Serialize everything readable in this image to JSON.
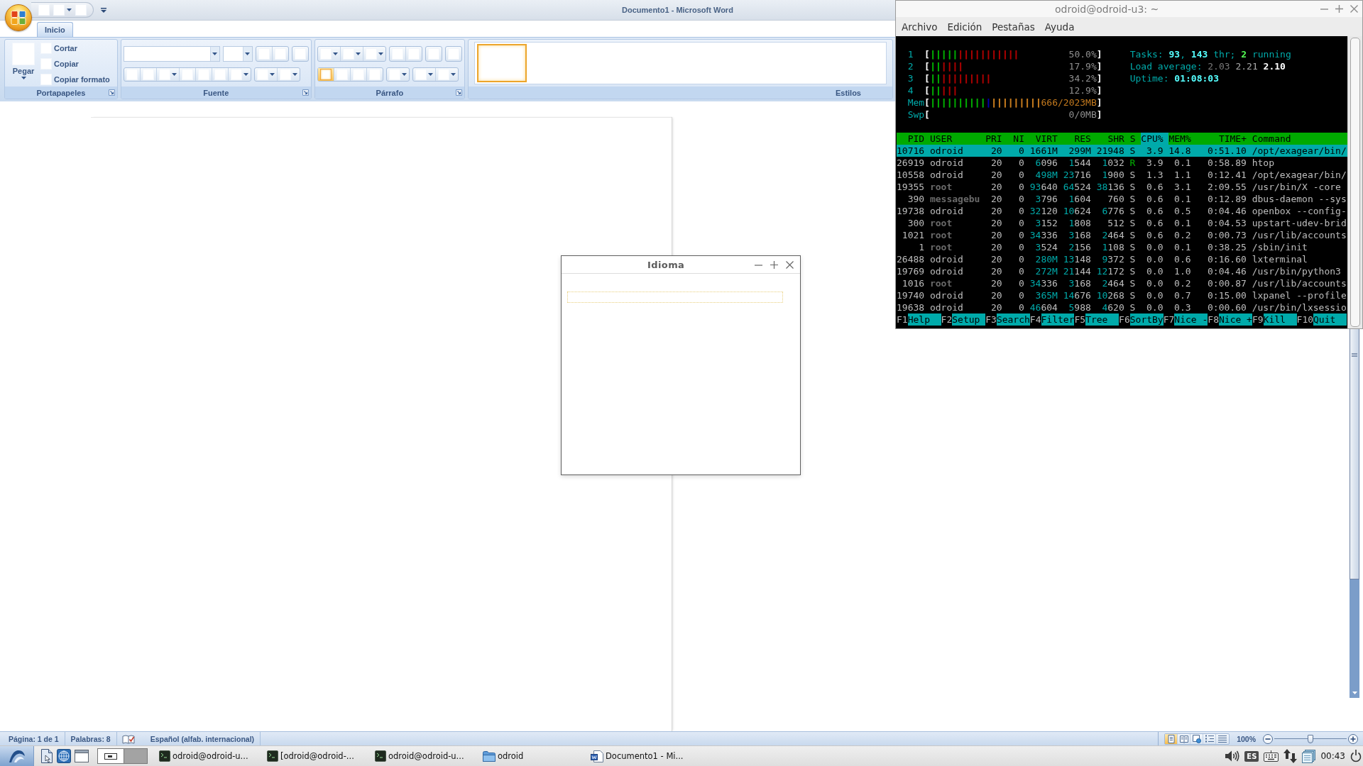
{
  "word": {
    "title": "Documento1 - Microsoft Word",
    "quick_access": [
      {
        "kind": "plain"
      },
      {
        "kind": "split"
      },
      {
        "kind": "plain"
      }
    ],
    "tabs": [
      {
        "label": "Inicio",
        "selected": true
      }
    ],
    "groups": [
      {
        "kind": "clipboard",
        "label": "Portapapeles",
        "launcher": true,
        "paste": "Pegar",
        "actions": [
          "Cortar",
          "Copiar",
          "Copiar formato"
        ]
      },
      {
        "kind": "controls",
        "label": "Fuente",
        "launcher": true,
        "rows": [
          [
            {
              "kind": "fontname"
            },
            {
              "kind": "fontsize"
            },
            {
              "kind": "group",
              "buttons": [
                {
                  "kind": "plain"
                },
                {
                  "kind": "plain"
                }
              ]
            },
            {
              "kind": "group",
              "buttons": [
                {
                  "kind": "plain"
                }
              ]
            }
          ],
          [
            {
              "kind": "group",
              "buttons": [
                {
                  "kind": "plain"
                },
                {
                  "kind": "plain"
                },
                {
                  "kind": "split"
                },
                {
                  "kind": "plain"
                },
                {
                  "kind": "plain"
                },
                {
                  "kind": "plain"
                },
                {
                  "kind": "split"
                }
              ]
            },
            {
              "kind": "group",
              "buttons": [
                {
                  "kind": "split"
                },
                {
                  "kind": "split"
                }
              ]
            }
          ]
        ]
      },
      {
        "kind": "controls",
        "label": "Párrafo",
        "launcher": true,
        "rows": [
          [
            {
              "kind": "group",
              "buttons": [
                {
                  "kind": "split"
                },
                {
                  "kind": "split"
                },
                {
                  "kind": "split"
                }
              ]
            },
            {
              "kind": "group",
              "buttons": [
                {
                  "kind": "plain"
                },
                {
                  "kind": "plain"
                }
              ]
            },
            {
              "kind": "group",
              "buttons": [
                {
                  "kind": "plain"
                }
              ]
            },
            {
              "kind": "group",
              "buttons": [
                {
                  "kind": "plain"
                }
              ]
            }
          ],
          [
            {
              "kind": "group",
              "buttons": [
                {
                  "kind": "plain",
                  "selected": true
                },
                {
                  "kind": "plain",
                  "selected": false
                },
                {
                  "kind": "plain",
                  "selected": false
                },
                {
                  "kind": "plain",
                  "selected": false
                }
              ]
            },
            {
              "kind": "group",
              "buttons": [
                {
                  "kind": "split"
                }
              ]
            },
            {
              "kind": "group",
              "buttons": [
                {
                  "kind": "split"
                },
                {
                  "kind": "split"
                }
              ]
            }
          ]
        ]
      },
      {
        "kind": "styles",
        "label": "Estilos",
        "launcher": false,
        "styles": [
          {
            "selected": true
          }
        ]
      }
    ],
    "status": {
      "items": [
        {
          "kind": "text",
          "text": "Página: 1 de 1"
        },
        {
          "kind": "text",
          "text": "Palabras: 8"
        },
        {
          "kind": "spelling"
        },
        {
          "kind": "text",
          "text": "Español (alfab. internacional)"
        }
      ],
      "views": [
        {
          "kind": "print",
          "selected": true
        },
        {
          "kind": "reading",
          "selected": false
        },
        {
          "kind": "web",
          "selected": false
        },
        {
          "kind": "outline",
          "selected": false
        },
        {
          "kind": "draft",
          "selected": false
        }
      ],
      "zoom": {
        "label": "100%",
        "level": 0.5
      }
    }
  },
  "terminal": {
    "title": "odroid@odroid-u3: ~",
    "menu": [
      "Archivo",
      "Edición",
      "Pestañas",
      "Ayuda"
    ],
    "meters": [
      {
        "label": "1",
        "open": "[",
        "bars": [
          {
            "text": "|||||",
            "color": "#00aa00"
          },
          {
            "text": "|||||||||||",
            "color": "#aa0000"
          }
        ],
        "reading": "50.0%",
        "close": "]"
      },
      {
        "label": "2",
        "open": "[",
        "bars": [
          {
            "text": "||",
            "color": "#00aa00"
          },
          {
            "text": "||||",
            "color": "#aa0000"
          }
        ],
        "reading": "17.9%",
        "close": "]"
      },
      {
        "label": "3",
        "open": "[",
        "bars": [
          {
            "text": "||",
            "color": "#00aa00"
          },
          {
            "text": "|||||||||",
            "color": "#aa0000"
          }
        ],
        "reading": "34.2%",
        "close": "]"
      },
      {
        "label": "4",
        "open": "[",
        "bars": [
          {
            "text": "||",
            "color": "#00aa00"
          },
          {
            "text": "|||",
            "color": "#aa0000"
          }
        ],
        "reading": "12.9%",
        "close": "]"
      },
      {
        "label": "Mem",
        "open": "[",
        "bars": [
          {
            "text": "||||||||||",
            "color": "#00aa00"
          },
          {
            "text": "|",
            "color": "#0000aa"
          },
          {
            "text": "|||||||||",
            "color": "#c47a1e"
          }
        ],
        "reading": "666/2023MB",
        "close": "]"
      },
      {
        "label": "Swp",
        "open": "[",
        "reading": "0/0MB",
        "close": "]"
      }
    ],
    "summary": [
      [
        {
          "kind": "label",
          "text": "Tasks: "
        },
        {
          "kind": "value",
          "text": "93"
        },
        {
          "kind": "label",
          "text": ", "
        },
        {
          "kind": "value",
          "text": "143"
        },
        {
          "kind": "label",
          "text": " thr; "
        },
        {
          "kind": "good",
          "text": "2"
        },
        {
          "kind": "label",
          "text": " running"
        }
      ],
      [
        {
          "kind": "label",
          "text": "Load average: "
        },
        {
          "kind": "dim",
          "text": "2.03 "
        },
        {
          "kind": "plain",
          "text": "2.21 "
        },
        {
          "kind": "strong",
          "text": "2.10"
        }
      ],
      [
        {
          "kind": "label",
          "text": "Uptime: "
        },
        {
          "kind": "value",
          "text": "01:08:03"
        }
      ]
    ],
    "columns": [
      {
        "label": "PID",
        "selected": false
      },
      {
        "label": "USER",
        "selected": false
      },
      {
        "label": "PRI",
        "selected": false
      },
      {
        "label": "NI",
        "selected": false
      },
      {
        "label": "VIRT",
        "selected": false
      },
      {
        "label": "RES",
        "selected": false
      },
      {
        "label": "SHR",
        "selected": false
      },
      {
        "label": "S",
        "selected": false
      },
      {
        "label": "CPU%",
        "selected": true
      },
      {
        "label": "MEM%",
        "selected": false
      },
      {
        "label": "TIME+",
        "selected": false
      },
      {
        "label": "Command",
        "selected": false
      }
    ],
    "rows": [
      {
        "pid": "10716",
        "user": "odroid",
        "pri": "20",
        "ni": "0",
        "virt": "1661M",
        "res": "299M",
        "shr": "21948",
        "state": "S",
        "cpu": "3.9",
        "mem": "14.8",
        "time": "0:51.10",
        "command": "/opt/exagear/bin/",
        "selected": true,
        "other_user": false,
        "running": false
      },
      {
        "pid": "26919",
        "user": "odroid",
        "pri": "20",
        "ni": "0",
        "virt": "6096",
        "res": "1544",
        "shr": "1032",
        "state": "R",
        "cpu": "3.9",
        "mem": "0.1",
        "time": "0:58.89",
        "command": "htop",
        "selected": false,
        "other_user": false,
        "running": true
      },
      {
        "pid": "10558",
        "user": "odroid",
        "pri": "20",
        "ni": "0",
        "virt": "498M",
        "res": "23716",
        "shr": "1900",
        "state": "S",
        "cpu": "1.3",
        "mem": "1.1",
        "time": "0:12.41",
        "command": "/opt/exagear/bin/",
        "selected": false,
        "other_user": false,
        "running": false
      },
      {
        "pid": "19355",
        "user": "root",
        "pri": "20",
        "ni": "0",
        "virt": "93640",
        "res": "64524",
        "shr": "38136",
        "state": "S",
        "cpu": "0.6",
        "mem": "3.1",
        "time": "2:09.55",
        "command": "/usr/bin/X -core",
        "selected": false,
        "other_user": true,
        "running": false
      },
      {
        "pid": "390",
        "user": "messagebu",
        "pri": "20",
        "ni": "0",
        "virt": "3796",
        "res": "1604",
        "shr": "760",
        "state": "S",
        "cpu": "0.6",
        "mem": "0.1",
        "time": "0:12.89",
        "command": "dbus-daemon --sys",
        "selected": false,
        "other_user": true,
        "running": false
      },
      {
        "pid": "19738",
        "user": "odroid",
        "pri": "20",
        "ni": "0",
        "virt": "32120",
        "res": "10624",
        "shr": "6776",
        "state": "S",
        "cpu": "0.6",
        "mem": "0.5",
        "time": "0:04.46",
        "command": "openbox --config-",
        "selected": false,
        "other_user": false,
        "running": false
      },
      {
        "pid": "300",
        "user": "root",
        "pri": "20",
        "ni": "0",
        "virt": "3152",
        "res": "1808",
        "shr": "512",
        "state": "S",
        "cpu": "0.6",
        "mem": "0.1",
        "time": "0:04.53",
        "command": "upstart-udev-brid",
        "selected": false,
        "other_user": true,
        "running": false
      },
      {
        "pid": "1021",
        "user": "root",
        "pri": "20",
        "ni": "0",
        "virt": "34336",
        "res": "3168",
        "shr": "2464",
        "state": "S",
        "cpu": "0.6",
        "mem": "0.2",
        "time": "0:00.73",
        "command": "/usr/lib/accounts",
        "selected": false,
        "other_user": true,
        "running": false
      },
      {
        "pid": "1",
        "user": "root",
        "pri": "20",
        "ni": "0",
        "virt": "3524",
        "res": "2156",
        "shr": "1108",
        "state": "S",
        "cpu": "0.0",
        "mem": "0.1",
        "time": "0:38.25",
        "command": "/sbin/init",
        "selected": false,
        "other_user": true,
        "running": false
      },
      {
        "pid": "26488",
        "user": "odroid",
        "pri": "20",
        "ni": "0",
        "virt": "280M",
        "res": "13148",
        "shr": "9372",
        "state": "S",
        "cpu": "0.0",
        "mem": "0.6",
        "time": "0:16.60",
        "command": "lxterminal",
        "selected": false,
        "other_user": false,
        "running": false
      },
      {
        "pid": "19769",
        "user": "odroid",
        "pri": "20",
        "ni": "0",
        "virt": "272M",
        "res": "21144",
        "shr": "12172",
        "state": "S",
        "cpu": "0.0",
        "mem": "1.0",
        "time": "0:04.46",
        "command": "/usr/bin/python3",
        "selected": false,
        "other_user": false,
        "running": false
      },
      {
        "pid": "1016",
        "user": "root",
        "pri": "20",
        "ni": "0",
        "virt": "34336",
        "res": "3168",
        "shr": "2464",
        "state": "S",
        "cpu": "0.0",
        "mem": "0.2",
        "time": "0:00.87",
        "command": "/usr/lib/accounts",
        "selected": false,
        "other_user": true,
        "running": false
      },
      {
        "pid": "19740",
        "user": "odroid",
        "pri": "20",
        "ni": "0",
        "virt": "365M",
        "res": "14676",
        "shr": "10268",
        "state": "S",
        "cpu": "0.0",
        "mem": "0.7",
        "time": "0:15.00",
        "command": "lxpanel --profile",
        "selected": false,
        "other_user": false,
        "running": false
      },
      {
        "pid": "19638",
        "user": "odroid",
        "pri": "20",
        "ni": "0",
        "virt": "46604",
        "res": "5988",
        "shr": "4620",
        "state": "S",
        "cpu": "0.0",
        "mem": "0.3",
        "time": "0:00.60",
        "command": "/usr/bin/lxsessio",
        "selected": false,
        "other_user": false,
        "running": false
      }
    ],
    "keys": [
      {
        "key": "F1",
        "action": "Help"
      },
      {
        "key": "F2",
        "action": "Setup"
      },
      {
        "key": "F3",
        "action": "Search"
      },
      {
        "key": "F4",
        "action": "Filter"
      },
      {
        "key": "F5",
        "action": "Tree"
      },
      {
        "key": "F6",
        "action": "SortBy"
      },
      {
        "key": "F7",
        "action": "Nice -"
      },
      {
        "key": "F8",
        "action": "Nice +"
      },
      {
        "key": "F9",
        "action": "Kill"
      },
      {
        "key": "F10",
        "action": "Quit"
      }
    ]
  },
  "dialog": {
    "title": "Idioma"
  },
  "taskbar": {
    "launchers": [
      {
        "kind": "files"
      },
      {
        "kind": "web"
      },
      {
        "kind": "desktop"
      }
    ],
    "desktops": [
      {
        "selected": true
      },
      {
        "selected": false
      }
    ],
    "tasks": [
      {
        "kind": "terminal",
        "label": "odroid@odroid-u..."
      },
      {
        "kind": "terminal",
        "label": "[odroid@odroid-..."
      },
      {
        "kind": "terminal",
        "label": "odroid@odroid-u..."
      },
      {
        "kind": "folder",
        "label": "odroid"
      },
      {
        "kind": "document",
        "label": "Documento1 - Mi..."
      }
    ],
    "layout": "ES",
    "clock": "00:43"
  }
}
